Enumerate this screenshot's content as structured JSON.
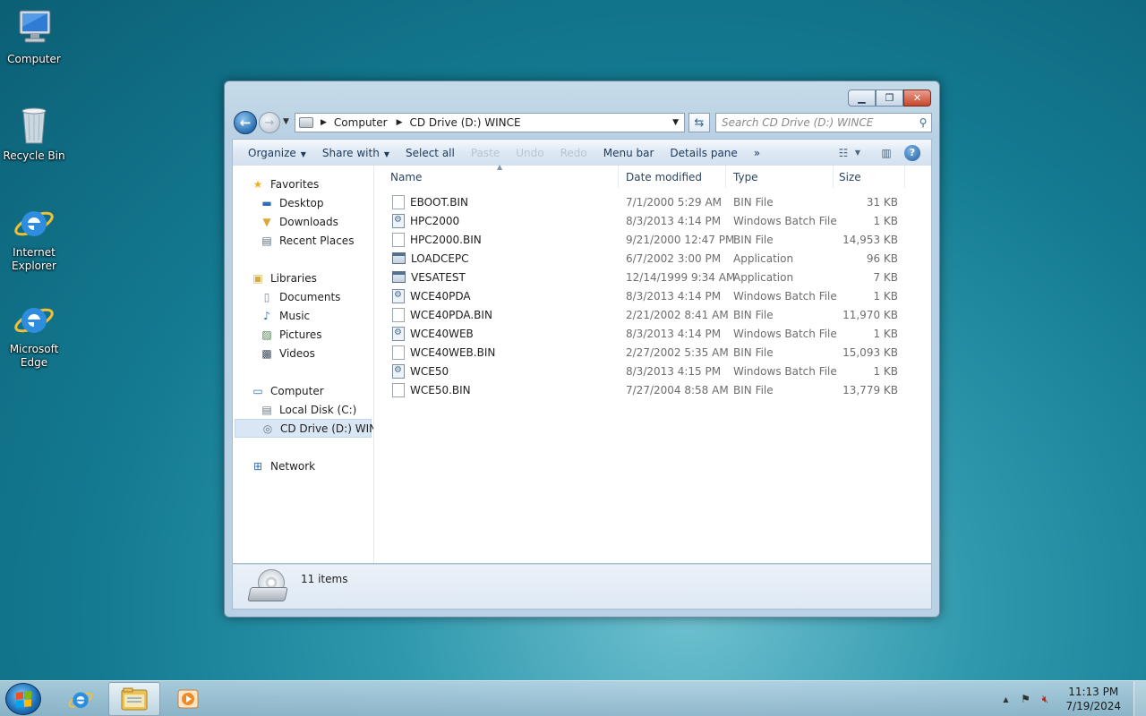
{
  "desktop": {
    "icons": [
      {
        "label": "Computer"
      },
      {
        "label": "Recycle Bin"
      },
      {
        "label": "Internet Explorer"
      },
      {
        "label": "Microsoft Edge"
      }
    ]
  },
  "window": {
    "address": {
      "crumbs": [
        "Computer",
        "CD Drive (D:) WINCE"
      ]
    },
    "search": {
      "placeholder": "Search CD Drive (D:) WINCE"
    },
    "commands": {
      "organize": "Organize",
      "share_with": "Share with",
      "select_all": "Select all",
      "paste": "Paste",
      "undo": "Undo",
      "redo": "Redo",
      "menu_bar": "Menu bar",
      "details_pane": "Details pane",
      "more": "»"
    },
    "nav": {
      "favorites": "Favorites",
      "desktop": "Desktop",
      "downloads": "Downloads",
      "recent_places": "Recent Places",
      "libraries": "Libraries",
      "documents": "Documents",
      "music": "Music",
      "pictures": "Pictures",
      "videos": "Videos",
      "computer": "Computer",
      "local_disk": "Local Disk (C:)",
      "cd_drive": "CD Drive (D:) WINCE",
      "network": "Network"
    },
    "columns": {
      "name": "Name",
      "date": "Date modified",
      "type": "Type",
      "size": "Size"
    },
    "files": [
      {
        "name": "EBOOT.BIN",
        "date": "7/1/2000 5:29 AM",
        "type": "BIN File",
        "size": "31 KB",
        "icon": "file"
      },
      {
        "name": "HPC2000",
        "date": "8/3/2013 4:14 PM",
        "type": "Windows Batch File",
        "size": "1 KB",
        "icon": "batch"
      },
      {
        "name": "HPC2000.BIN",
        "date": "9/21/2000 12:47 PM",
        "type": "BIN File",
        "size": "14,953 KB",
        "icon": "file"
      },
      {
        "name": "LOADCEPC",
        "date": "6/7/2002 3:00 PM",
        "type": "Application",
        "size": "96 KB",
        "icon": "app"
      },
      {
        "name": "VESATEST",
        "date": "12/14/1999 9:34 AM",
        "type": "Application",
        "size": "7 KB",
        "icon": "app"
      },
      {
        "name": "WCE40PDA",
        "date": "8/3/2013 4:14 PM",
        "type": "Windows Batch File",
        "size": "1 KB",
        "icon": "batch"
      },
      {
        "name": "WCE40PDA.BIN",
        "date": "2/21/2002 8:41 AM",
        "type": "BIN File",
        "size": "11,970 KB",
        "icon": "file"
      },
      {
        "name": "WCE40WEB",
        "date": "8/3/2013 4:14 PM",
        "type": "Windows Batch File",
        "size": "1 KB",
        "icon": "batch"
      },
      {
        "name": "WCE40WEB.BIN",
        "date": "2/27/2002 5:35 AM",
        "type": "BIN File",
        "size": "15,093 KB",
        "icon": "file"
      },
      {
        "name": "WCE50",
        "date": "8/3/2013 4:15 PM",
        "type": "Windows Batch File",
        "size": "1 KB",
        "icon": "batch"
      },
      {
        "name": "WCE50.BIN",
        "date": "7/27/2004 8:58 AM",
        "type": "BIN File",
        "size": "13,779 KB",
        "icon": "file"
      }
    ],
    "status": {
      "item_count": "11 items"
    }
  },
  "taskbar": {
    "clock_time": "11:13 PM",
    "clock_date": "7/19/2024",
    "tray_up": "▲"
  },
  "colors": {
    "desktop_bg": "#147b92",
    "close_button": "#c8452b",
    "command_text": "#1e395b"
  }
}
